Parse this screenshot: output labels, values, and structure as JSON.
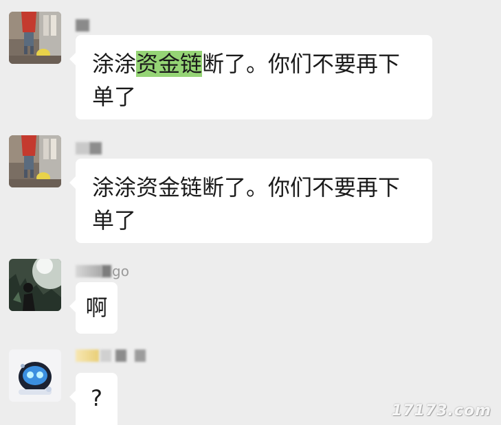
{
  "messages": [
    {
      "sender_visible": "",
      "text_before": "涂涂",
      "text_highlight": "资金链",
      "text_after": "断了。你们不要再下单了"
    },
    {
      "sender_visible": "",
      "text": "涂涂资金链断了。你们不要再下单了"
    },
    {
      "sender_visible": "go",
      "text": "啊"
    },
    {
      "sender_visible": "",
      "text": "?"
    }
  ],
  "watermark": "17173.com",
  "colors": {
    "background": "#ededed",
    "bubble": "#ffffff",
    "highlight": "#95d475",
    "name_text": "#9a9a9a"
  },
  "icons": {
    "avatar_1": "photo-avatar-red-shirt",
    "avatar_2": "photo-avatar-red-shirt",
    "avatar_3": "photo-avatar-forest-silhouette",
    "avatar_4": "photo-avatar-robot-cartoon"
  }
}
